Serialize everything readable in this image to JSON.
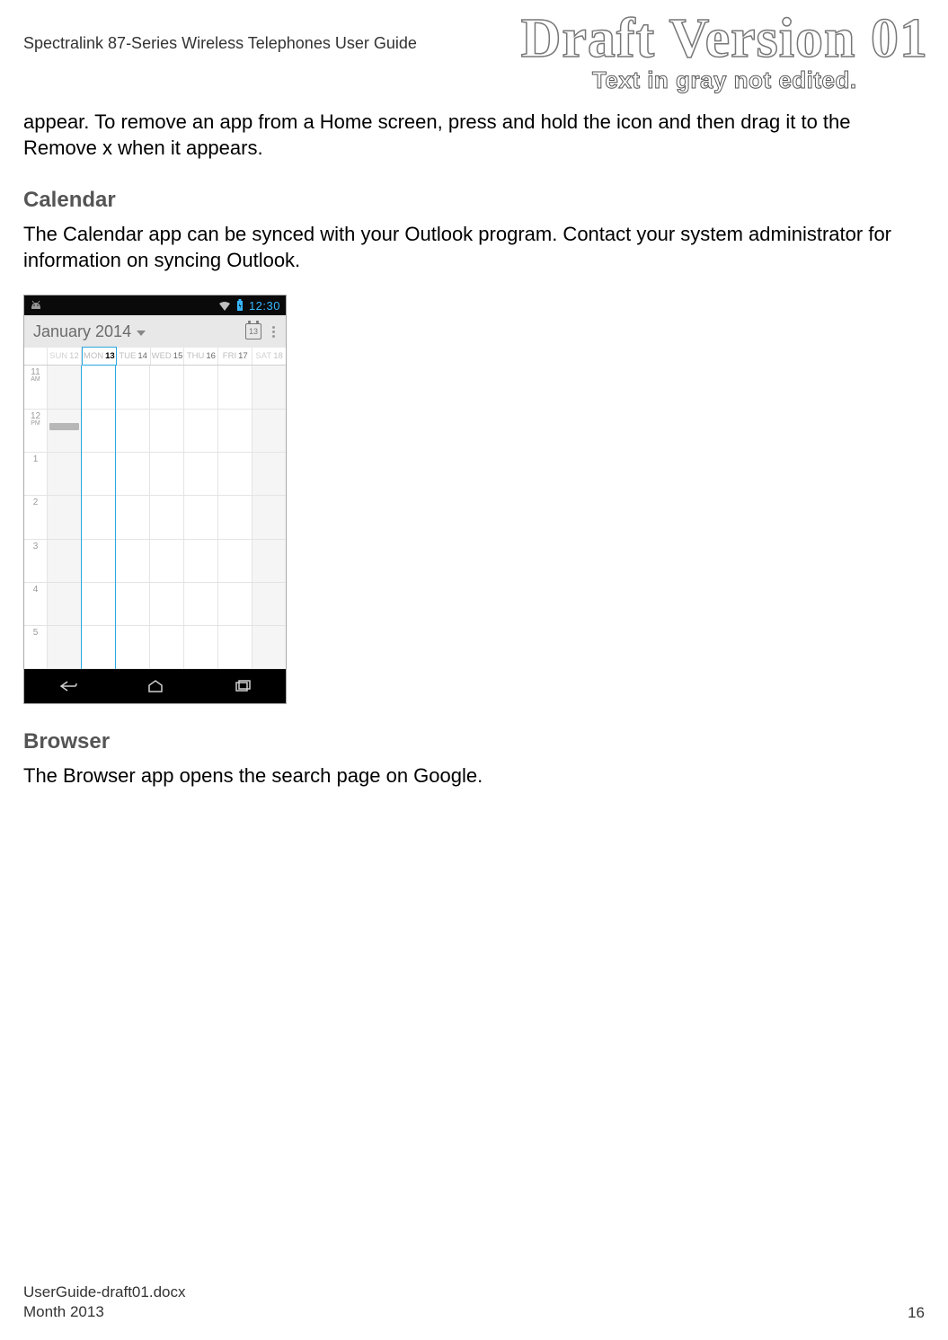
{
  "header": {
    "doc_title": "Spectralink 87-Series Wireless Telephones User Guide",
    "watermark_main": "Draft Version 01",
    "watermark_sub": "Text in gray not edited."
  },
  "body": {
    "intro_continuation": "appear. To remove an app from a Home screen, press and hold the icon and then drag it to the Remove x when it appears.",
    "calendar_heading": "Calendar",
    "calendar_text": "The Calendar app can be synced with your Outlook program. Contact your system administrator for information on syncing Outlook.",
    "browser_heading": "Browser",
    "browser_text": "The Browser app opens the search page on Google."
  },
  "calendar_screenshot": {
    "status_time": "12:30",
    "month_title": "January 2014",
    "today_badge": "13",
    "days": [
      {
        "label": "SUN",
        "num": "12",
        "current": false,
        "inactive": true
      },
      {
        "label": "MON",
        "num": "13",
        "current": true,
        "inactive": false
      },
      {
        "label": "TUE",
        "num": "14",
        "current": false,
        "inactive": false
      },
      {
        "label": "WED",
        "num": "15",
        "current": false,
        "inactive": false
      },
      {
        "label": "THU",
        "num": "16",
        "current": false,
        "inactive": false
      },
      {
        "label": "FRI",
        "num": "17",
        "current": false,
        "inactive": false
      },
      {
        "label": "SAT",
        "num": "18",
        "current": false,
        "inactive": true
      }
    ],
    "times": [
      {
        "h": "11",
        "sub": "AM"
      },
      {
        "h": "12",
        "sub": "PM"
      },
      {
        "h": "1",
        "sub": ""
      },
      {
        "h": "2",
        "sub": ""
      },
      {
        "h": "3",
        "sub": ""
      },
      {
        "h": "4",
        "sub": ""
      },
      {
        "h": "5",
        "sub": ""
      }
    ]
  },
  "footer": {
    "filename": "UserGuide-draft01.docx",
    "date": "Month 2013",
    "page": "16"
  }
}
